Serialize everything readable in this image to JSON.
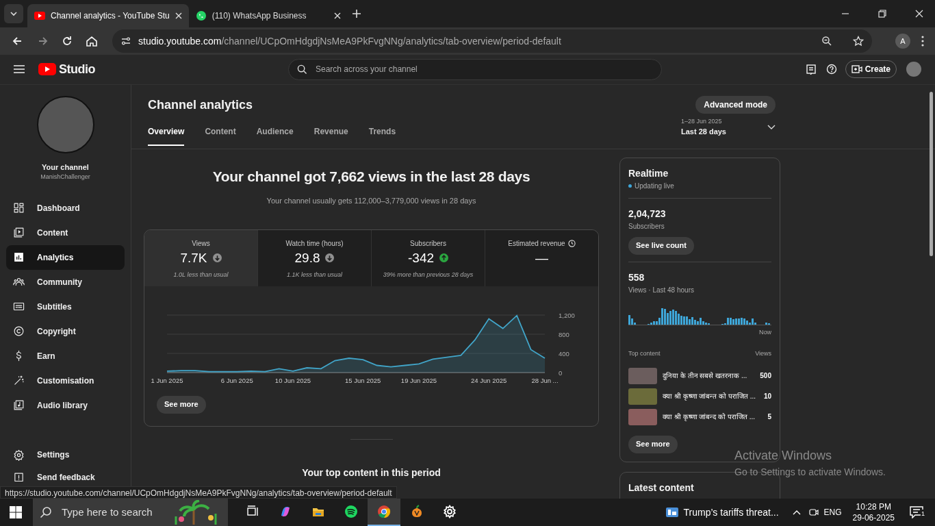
{
  "browser": {
    "tabs": [
      {
        "title": "Channel analytics - YouTube Stu",
        "kind": "youtube",
        "selected": true
      },
      {
        "title": "(110) WhatsApp Business",
        "kind": "whatsapp",
        "selected": false
      }
    ],
    "url": {
      "host": "studio.youtube.com",
      "path": "/channel/UCpOmHdgdjNsMeA9PkFvgNNg/analytics/tab-overview/period-default"
    },
    "profile_initial": "A"
  },
  "studio": {
    "logo_text": "Studio",
    "search_placeholder": "Search across your channel",
    "create_label": "Create"
  },
  "sidebar": {
    "channel_title": "Your channel",
    "channel_name": "ManishChallenger",
    "items": [
      {
        "label": "Dashboard",
        "kind": "dashboard",
        "selected": false
      },
      {
        "label": "Content",
        "kind": "content",
        "selected": false
      },
      {
        "label": "Analytics",
        "kind": "analytics",
        "selected": true
      },
      {
        "label": "Community",
        "kind": "community",
        "selected": false
      },
      {
        "label": "Subtitles",
        "kind": "subtitles",
        "selected": false
      },
      {
        "label": "Copyright",
        "kind": "copyright",
        "selected": false
      },
      {
        "label": "Earn",
        "kind": "earn",
        "selected": false
      },
      {
        "label": "Customisation",
        "kind": "customisation",
        "selected": false
      },
      {
        "label": "Audio library",
        "kind": "audio",
        "selected": false
      }
    ],
    "footer_items": [
      {
        "label": "Settings",
        "kind": "settings"
      },
      {
        "label": "Send feedback",
        "kind": "feedback"
      }
    ]
  },
  "page": {
    "title": "Channel analytics",
    "advanced_button": "Advanced mode",
    "date_range": "1–28 Jun 2025",
    "period": "Last 28 days",
    "tabs": [
      {
        "label": "Overview",
        "selected": true
      },
      {
        "label": "Content",
        "selected": false
      },
      {
        "label": "Audience",
        "selected": false
      },
      {
        "label": "Revenue",
        "selected": false
      },
      {
        "label": "Trends",
        "selected": false
      }
    ]
  },
  "summary": {
    "headline": "Your channel got 7,662 views in the last 28 days",
    "subline": "Your channel usually gets 112,000–3,779,000 views in 28 days"
  },
  "metrics": [
    {
      "label": "Views",
      "value": "7.7K",
      "kind": "down",
      "note": "1.0L less than usual",
      "selected": true
    },
    {
      "label": "Watch time (hours)",
      "value": "29.8",
      "kind": "down",
      "note": "1.1K less than usual",
      "selected": false
    },
    {
      "label": "Subscribers",
      "value": "-342",
      "kind": "up",
      "note": "39% more than previous 28 days",
      "selected": false
    },
    {
      "label": "Estimated revenue",
      "value": "—",
      "kind": "pending",
      "selected": false
    }
  ],
  "chart_data": {
    "type": "area",
    "categories": [
      "1 Jun 2025",
      null,
      null,
      null,
      null,
      "6 Jun 2025",
      null,
      null,
      null,
      "10 Jun 2025",
      null,
      null,
      null,
      null,
      "15 Jun 2025",
      null,
      null,
      null,
      "19 Jun 2025",
      null,
      null,
      null,
      null,
      "24 Jun 2025",
      null,
      null,
      null,
      "28 Jun ..."
    ],
    "series": [
      {
        "color": "#41a5c9",
        "values": [
          30,
          40,
          40,
          20,
          20,
          20,
          30,
          20,
          80,
          30,
          100,
          80,
          250,
          300,
          270,
          150,
          120,
          150,
          180,
          280,
          320,
          360,
          680,
          1120,
          920,
          1190,
          480,
          300
        ]
      }
    ],
    "yticks": [
      {
        "value": 0,
        "label": "0"
      },
      {
        "value": 400,
        "label": "400"
      },
      {
        "value": 800,
        "label": "800"
      },
      {
        "value": 1200,
        "label": "1,200"
      }
    ],
    "ylim": [
      0,
      1200
    ]
  },
  "see_more": "See more",
  "top_content_heading": "Your top content in this period",
  "realtime": {
    "title": "Realtime",
    "status": "Updating live",
    "subscribers": "2,04,723",
    "subscribers_label": "Subscribers",
    "live_button": "See live count",
    "views": "558",
    "views_label": "Views · Last 48 hours",
    "now_label": "Now",
    "top_content_label": "Top content",
    "views_column": "Views",
    "items": [
      {
        "title": "दुनिया के तीन सबसे खतरनाक ...",
        "views": "500"
      },
      {
        "title": "क्या श्री कृष्णा जांबन्त को पराजित ...",
        "views": "10"
      },
      {
        "title": "क्या श्री कृष्णा जांबन्द को पराजित ...",
        "views": "5"
      }
    ],
    "see_more": "See more"
  },
  "latest_content": {
    "title": "Latest content"
  },
  "status_url": "https://studio.youtube.com/channel/UCpOmHdgdjNsMeA9PkFvgNNg/analytics/tab-overview/period-default",
  "activation": {
    "title": "Activate Windows",
    "text": "Go to Settings to activate Windows."
  },
  "taskbar": {
    "search_placeholder": "Type here to search",
    "apps": [
      {
        "kind": "taskview",
        "selected": false
      },
      {
        "kind": "copilot",
        "selected": false
      },
      {
        "kind": "folder",
        "selected": false
      },
      {
        "kind": "spotify",
        "selected": false
      },
      {
        "kind": "chrome",
        "selected": true
      },
      {
        "kind": "fruit",
        "selected": false
      },
      {
        "kind": "gear",
        "selected": false
      }
    ],
    "news": "Trump’s tariffs threat...",
    "language": "ENG",
    "time": "10:28 PM",
    "date": "29-06-2025",
    "notifications": "1"
  }
}
